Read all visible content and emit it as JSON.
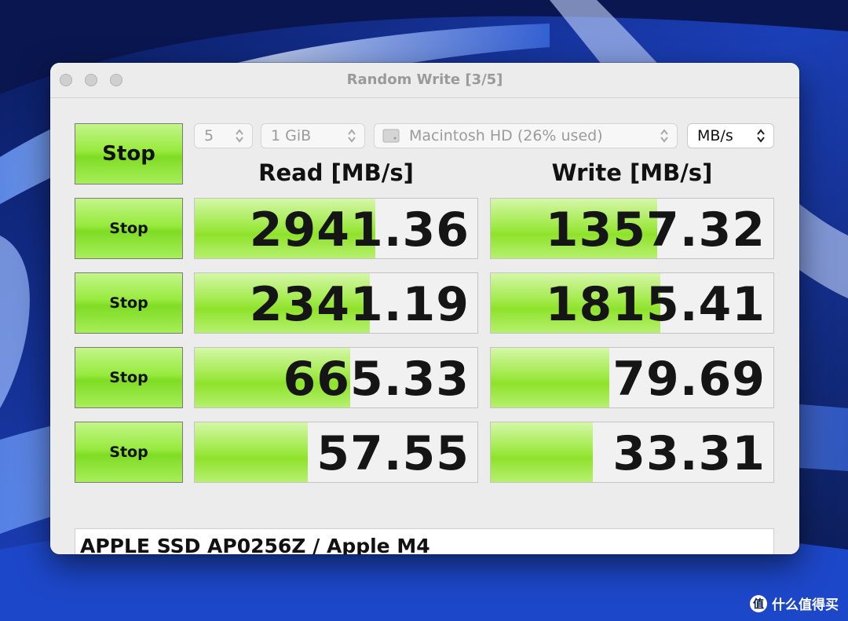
{
  "window": {
    "title": "Random Write [3/5]"
  },
  "toolbar": {
    "count_value": "5",
    "size_value": "1 GiB",
    "drive_value": "Macintosh HD (26% used)",
    "unit_value": "MB/s"
  },
  "main_button_label": "Stop",
  "columns": {
    "read_header": "Read [MB/s]",
    "write_header": "Write [MB/s]"
  },
  "rows": [
    {
      "button_label": "Stop",
      "read": "2941.36",
      "write": "1357.32",
      "read_fill": 0.64,
      "write_fill": 0.59
    },
    {
      "button_label": "Stop",
      "read": "2341.19",
      "write": "1815.41",
      "read_fill": 0.62,
      "write_fill": 0.6
    },
    {
      "button_label": "Stop",
      "read": "665.33",
      "write": "79.69",
      "read_fill": 0.55,
      "write_fill": 0.42
    },
    {
      "button_label": "Stop",
      "read": "57.55",
      "write": "33.31",
      "read_fill": 0.4,
      "write_fill": 0.36
    }
  ],
  "device_info": "APPLE SSD AP0256Z / Apple M4",
  "watermark": {
    "logo": "值",
    "text": "什么值得买"
  },
  "colors": {
    "bar_green": "#8fe22b",
    "button_green": "#97ea3d",
    "window_bg": "#ececec"
  }
}
